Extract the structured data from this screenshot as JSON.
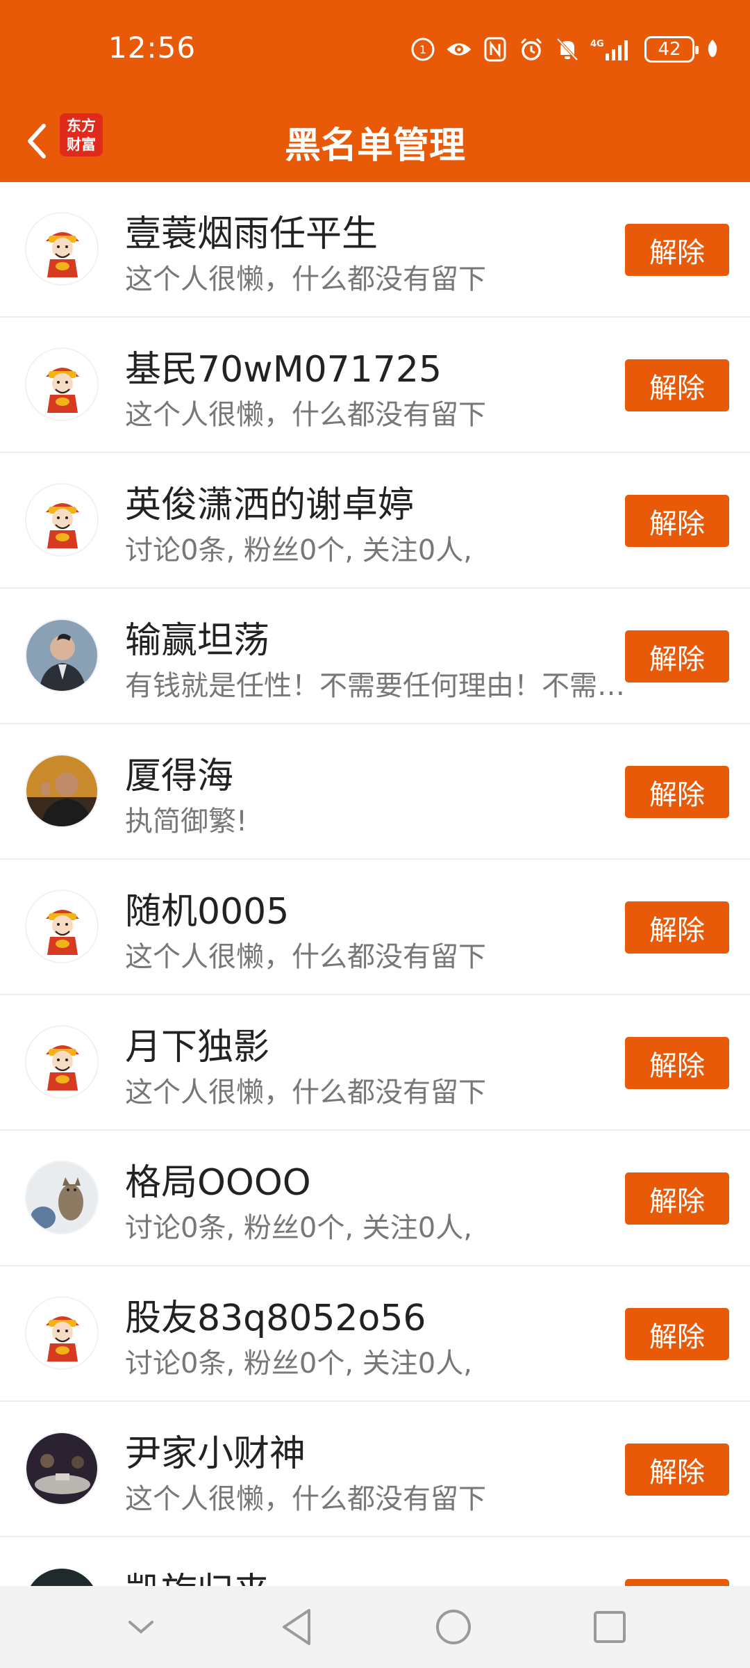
{
  "status_bar": {
    "time": "12:56",
    "battery": "42",
    "network": "4G",
    "icons": [
      "hd-icon",
      "eye-icon",
      "nfc-icon",
      "alarm-icon",
      "mute-icon",
      "signal-icon",
      "battery-icon",
      "leaf-icon"
    ]
  },
  "header": {
    "title": "黑名单管理",
    "logo_line1": "东方",
    "logo_line2": "财富",
    "accent_color": "#e85a08"
  },
  "button_label": "解除",
  "users": [
    {
      "name": "壹蓑烟雨任平生",
      "desc": "这个人很懒，什么都没有留下",
      "avatar": "caishen"
    },
    {
      "name": "基民70wM071725",
      "desc": "这个人很懒，什么都没有留下",
      "avatar": "caishen"
    },
    {
      "name": "英俊潇洒的谢卓婷",
      "desc": "讨论0条, 粉丝0个, 关注0人,",
      "avatar": "caishen"
    },
    {
      "name": "输赢坦荡",
      "desc": "有钱就是任性！不需要任何理由！不需要任何理由",
      "avatar": "photo-man-suit"
    },
    {
      "name": "厦得海",
      "desc": "执简御繁!",
      "avatar": "photo-man-thumb"
    },
    {
      "name": "随机0005",
      "desc": "这个人很懒，什么都没有留下",
      "avatar": "caishen"
    },
    {
      "name": "月下独影",
      "desc": "这个人很懒，什么都没有留下",
      "avatar": "caishen"
    },
    {
      "name": "格局OOOO",
      "desc": "讨论0条, 粉丝0个, 关注0人,",
      "avatar": "photo-cat"
    },
    {
      "name": "股友83q8052o56",
      "desc": "讨论0条, 粉丝0个, 关注0人,",
      "avatar": "caishen"
    },
    {
      "name": "尹家小财神",
      "desc": "这个人很懒，什么都没有留下",
      "avatar": "photo-dark"
    }
  ],
  "partial_user": {
    "name": "凯旋归来"
  },
  "system_nav": [
    "hide-icon",
    "back-icon",
    "home-icon",
    "recents-icon"
  ]
}
